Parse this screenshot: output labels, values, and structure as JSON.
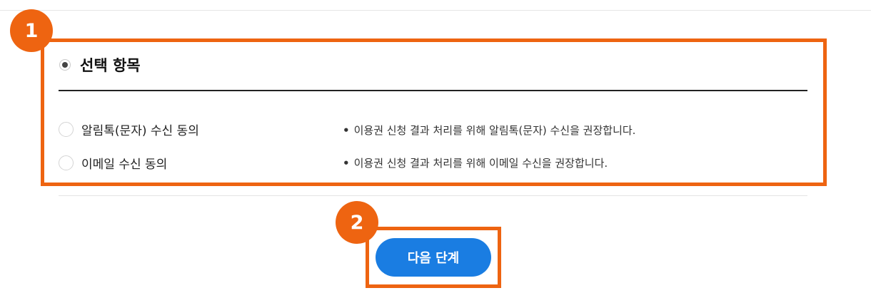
{
  "annotations": {
    "badge_1": "1",
    "badge_2": "2",
    "accent_color": "#ee6411"
  },
  "section": {
    "title": "선택 항목"
  },
  "options": [
    {
      "label": "알림톡(문자) 수신 동의",
      "description": "이용권 신청 결과 처리를 위해 알림톡(문자) 수신을 권장합니다.",
      "checked": false
    },
    {
      "label": "이메일 수신 동의",
      "description": "이용권 신청 결과 처리를 위해 이메일 수신을 권장합니다.",
      "checked": false
    }
  ],
  "bullet": "•",
  "next_button": {
    "label": "다음 단계",
    "color": "#1a7de2"
  }
}
